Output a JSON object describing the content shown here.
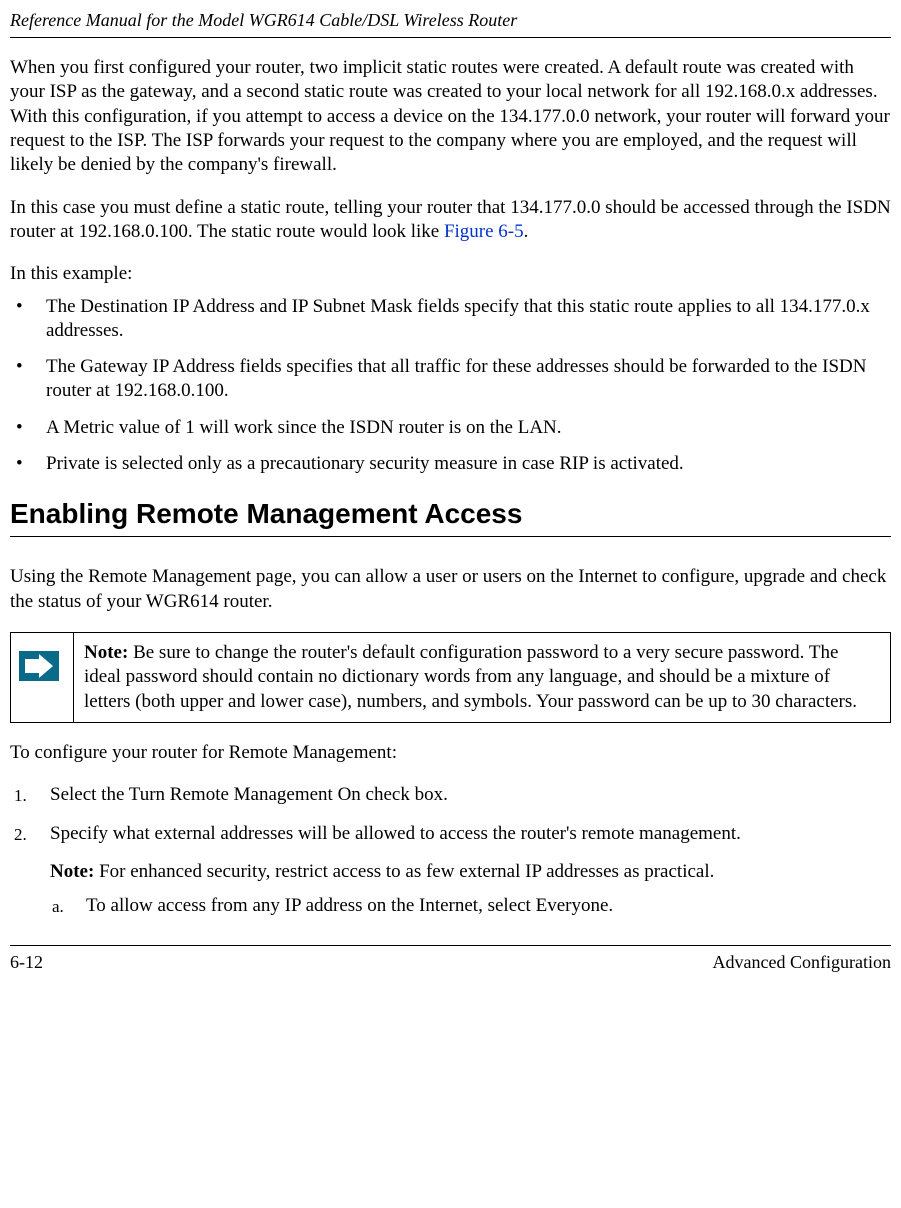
{
  "header": {
    "manual_title": "Reference Manual for the Model WGR614 Cable/DSL Wireless Router"
  },
  "para1": "When you first configured your router, two implicit static routes were created. A default route was created with your ISP as the gateway, and a second static route was created to your local network for all 192.168.0.x addresses. With this configuration, if you attempt to access a device on the 134.177.0.0 network, your router will forward your request to the ISP. The ISP forwards your request to the company where you are employed, and the request will likely be denied by the company's firewall.",
  "para2_part1": "In this case you must define a static route, telling your router that 134.177.0.0 should be accessed through the ISDN router at 192.168.0.100. The static route would look like ",
  "para2_link": "Figure 6-5",
  "para2_part2": ".",
  "in_this_example": "In this example:",
  "bullets": [
    "The Destination IP Address and IP Subnet Mask fields specify that this static route applies to all 134.177.0.x addresses.",
    "The Gateway IP Address fields specifies that all traffic for these addresses should be forwarded to the ISDN router at 192.168.0.100.",
    "A Metric value of 1 will work since the ISDN router is on the LAN.",
    "Private is selected only as a precautionary security measure in case RIP is activated."
  ],
  "section_heading": "Enabling Remote Management Access",
  "section_intro": "Using the Remote Management page, you can allow a user or users on the Internet to configure, upgrade and check the status of your WGR614 router.",
  "note": {
    "label": "Note:",
    "text": " Be sure to change the router's default configuration password to a very secure password. The ideal password should contain no dictionary words from any language, and should be a mixture of letters (both upper and lower case), numbers, and symbols. Your password can be up to 30 characters."
  },
  "configure_intro": "To configure your router for Remote Management:",
  "steps": [
    "Select the Turn Remote Management On check box.",
    "Specify what external addresses will be allowed to access the router's remote management."
  ],
  "sub_note": {
    "label": "Note:",
    "text": " For enhanced security, restrict access to as few external IP addresses as practical."
  },
  "alpha_steps": [
    "To allow access from any IP address on the Internet, select Everyone."
  ],
  "footer": {
    "page_number": "6-12",
    "section_name": "Advanced Configuration"
  }
}
